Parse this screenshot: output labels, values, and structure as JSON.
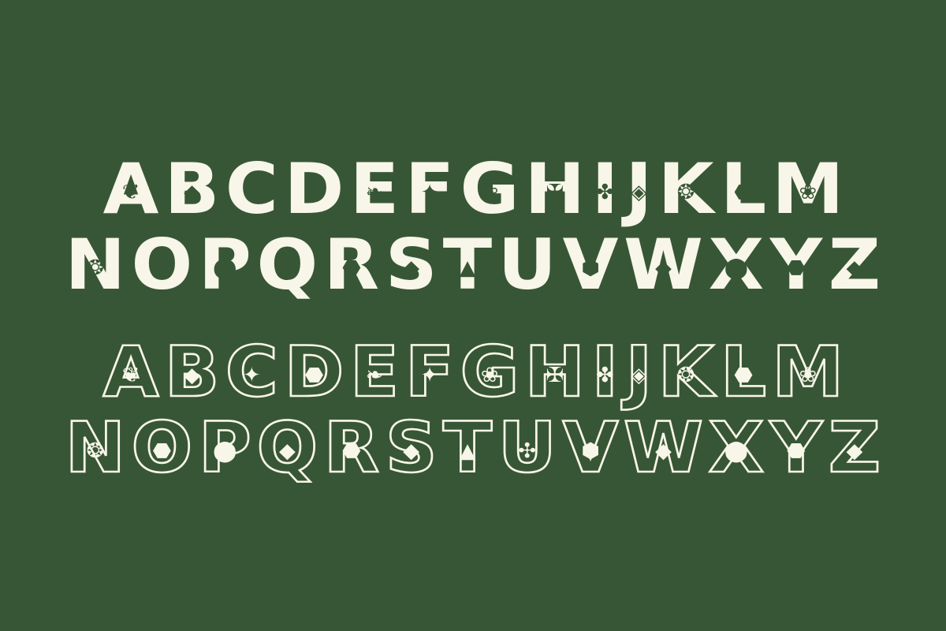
{
  "palette": {
    "background": "#375636",
    "letter": "#f8f6e8"
  },
  "solid_rows": [
    {
      "letters": [
        "A",
        "B",
        "C",
        "D",
        "E",
        "F",
        "G",
        "H",
        "I",
        "J",
        "K",
        "L",
        "M"
      ],
      "icons": [
        "fly-icon",
        "cockroach-icon",
        "moth-icon",
        "beetle-icon",
        "butterfly-icon",
        "mosquito-icon",
        "moth-icon",
        "dragonfly-icon",
        "ant-icon",
        "cicada-icon",
        "bee-icon",
        "beetle-icon",
        "moth-icon"
      ]
    },
    {
      "letters": [
        "N",
        "O",
        "P",
        "Q",
        "R",
        "S",
        "T",
        "U",
        "V",
        "W",
        "X",
        "Y",
        "Z"
      ],
      "icons": [
        "bee-icon",
        "beetle-icon",
        "ladybug-icon",
        "cockroach-icon",
        "beetle-icon",
        "cockroach-icon",
        "stink-bug-icon",
        "cricket-icon",
        "tick-icon",
        "cockroach-icon",
        "ladybug-icon",
        "beetle-icon",
        "cockroach-icon"
      ]
    }
  ],
  "outline_rows": [
    {
      "letters": [
        "A",
        "B",
        "C",
        "D",
        "E",
        "F",
        "G",
        "H",
        "I",
        "J",
        "K",
        "L",
        "M"
      ],
      "icons": [
        "fly-icon",
        "cockroach-icon",
        "mosquito-icon",
        "beetle-icon",
        "butterfly-icon",
        "mosquito-icon",
        "moth-icon",
        "dragonfly-icon",
        "ant-icon",
        "cicada-icon",
        "bee-icon",
        "beetle-icon",
        "moth-icon"
      ]
    },
    {
      "letters": [
        "N",
        "O",
        "P",
        "Q",
        "R",
        "S",
        "T",
        "U",
        "V",
        "W",
        "X",
        "Y",
        "Z"
      ],
      "icons": [
        "bee-icon",
        "beetle-icon",
        "ladybug-icon",
        "cockroach-icon",
        "beetle-icon",
        "cockroach-icon",
        "stink-bug-icon",
        "cricket-icon",
        "tick-icon",
        "cockroach-icon",
        "ladybug-icon",
        "beetle-icon",
        "cockroach-icon"
      ]
    }
  ]
}
